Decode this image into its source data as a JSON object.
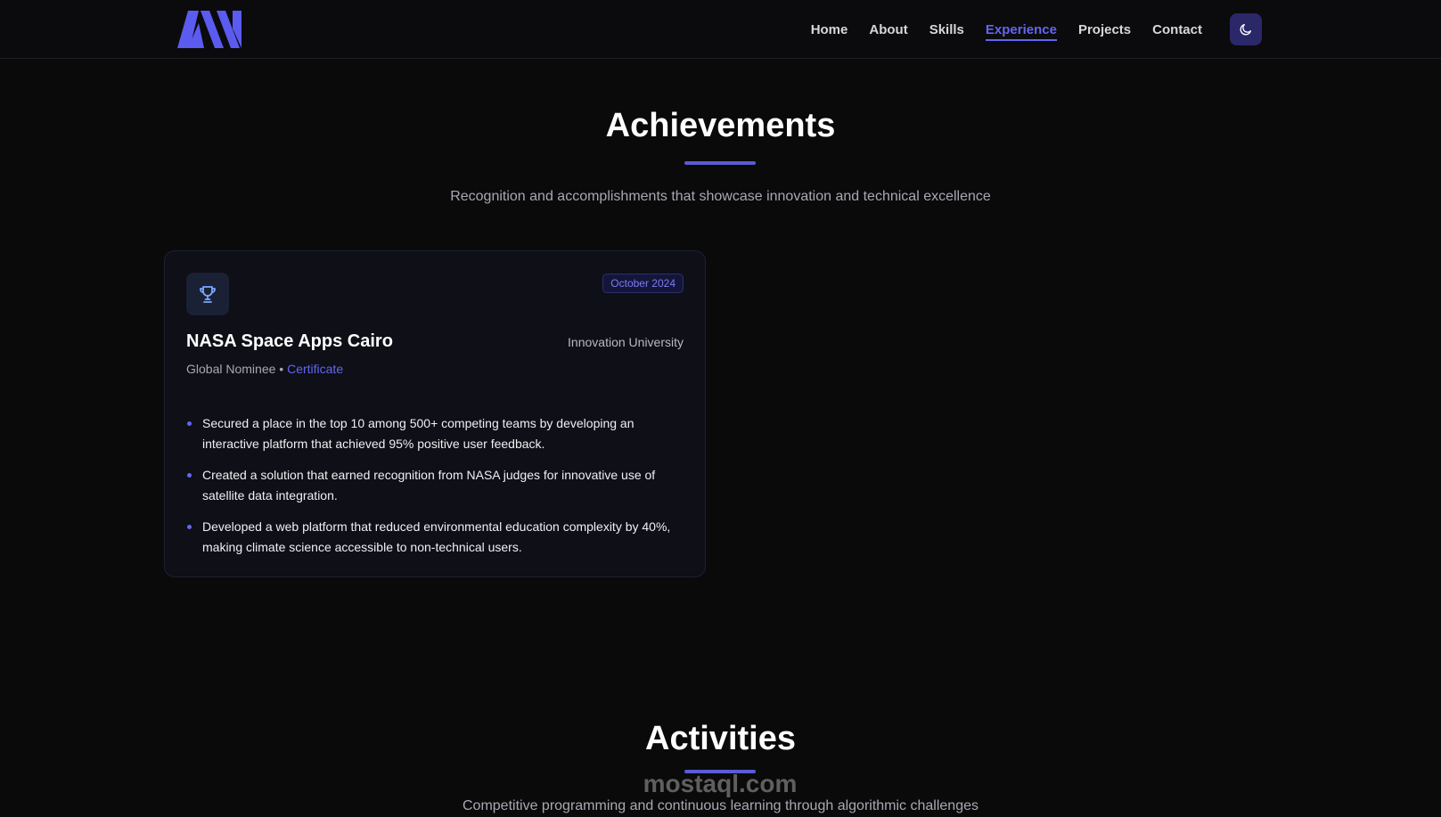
{
  "nav": {
    "links": [
      "Home",
      "About",
      "Skills",
      "Experience",
      "Projects",
      "Contact"
    ],
    "active": "Experience",
    "icons": {
      "logo": "brand-logo",
      "theme": "moon-icon"
    },
    "colors": {
      "accent": "#6366f1",
      "toggle_bg": "#2a2868"
    }
  },
  "achievements": {
    "title": "Achievements",
    "subtitle": "Recognition and accomplishments that showcase innovation and technical excellence",
    "card": {
      "icon": "trophy-icon",
      "date": "October 2024",
      "title": "NASA Space Apps Cairo",
      "organization": "Innovation University",
      "role": "Global Nominee",
      "separator": "•",
      "link_label": "Certificate",
      "bullets": [
        "Secured a place in the top 10 among 500+ competing teams by developing an interactive platform that achieved 95% positive user feedback.",
        "Created a solution that earned recognition from NASA judges for innovative use of satellite data integration.",
        "Developed a web platform that reduced environmental education complexity by 40%, making climate science accessible to non-technical users."
      ]
    }
  },
  "activities": {
    "title": "Activities",
    "subtitle": "Competitive programming and continuous learning through algorithmic challenges"
  },
  "watermark": {
    "text": "mostaql.com"
  }
}
